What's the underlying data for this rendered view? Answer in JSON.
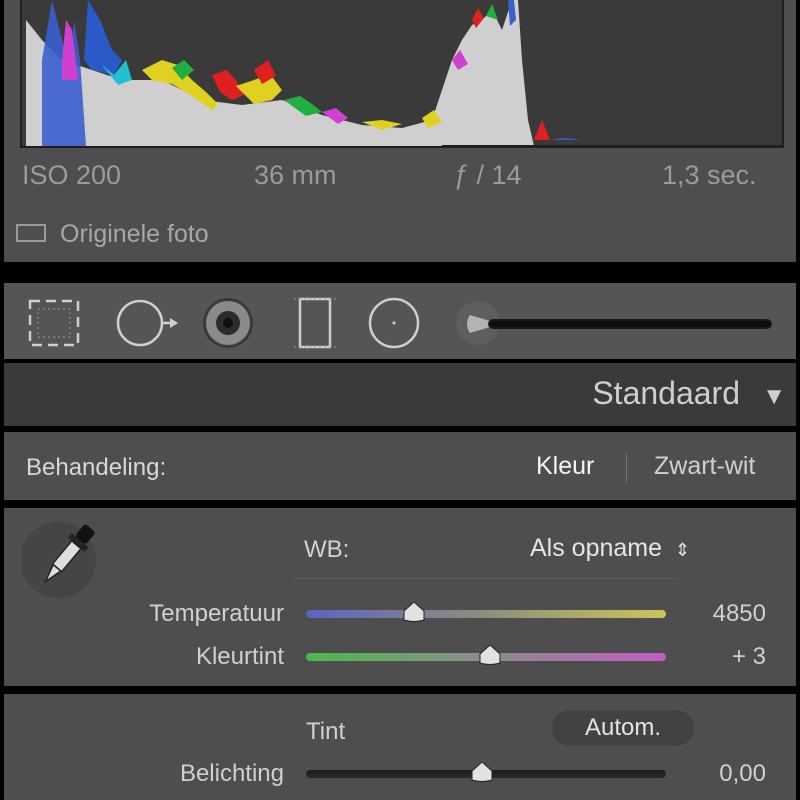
{
  "histogram": {
    "exif": {
      "iso": "ISO 200",
      "focal": "36 mm",
      "aperture": "ƒ / 14",
      "shutter": "1,3 sec."
    },
    "original_photo_label": "Originele foto"
  },
  "tools": [
    "crop-tool",
    "spot-removal-tool",
    "red-eye-tool",
    "graduated-filter-tool",
    "radial-filter-tool",
    "adjustment-brush-tool"
  ],
  "preset": {
    "label": "Standaard"
  },
  "treatment": {
    "label": "Behandeling:",
    "color": "Kleur",
    "bw": "Zwart-wit"
  },
  "white_balance": {
    "label": "WB:",
    "value": "Als opname",
    "temperature": {
      "label": "Temperatuur",
      "value": "4850",
      "position": 0.3
    },
    "tint": {
      "label": "Kleurtint",
      "value": "+ 3",
      "position": 0.51
    }
  },
  "tone": {
    "label": "Tint",
    "auto_button": "Autom.",
    "exposure": {
      "label": "Belichting",
      "value": "0,00",
      "position": 0.49
    }
  },
  "colors": {
    "panel": "#4e4e4e",
    "text": "#d0d0d0",
    "header": "#3a3a3a"
  }
}
